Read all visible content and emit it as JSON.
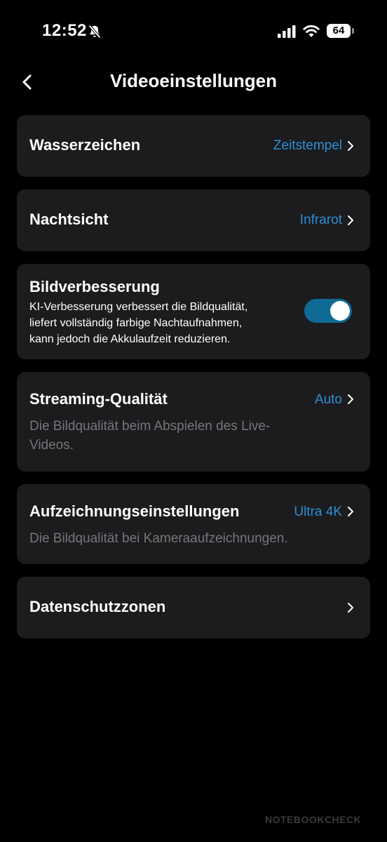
{
  "status": {
    "time": "12:52",
    "battery": "64",
    "icons": [
      "bell-slash-icon",
      "cellular-signal-icon",
      "wifi-icon",
      "battery-icon"
    ]
  },
  "header": {
    "title": "Videoeinstellungen",
    "back_icon": "chevron-left-icon"
  },
  "settings": {
    "watermark": {
      "title": "Wasserzeichen",
      "value": "Zeitstempel"
    },
    "night_vision": {
      "title": "Nachtsicht",
      "value": "Infrarot"
    },
    "enhancement": {
      "title": "Bildverbesserung",
      "desc_line1": "KI-Verbesserung verbessert die Bildqualität,",
      "desc_line2": "liefert vollständig farbige Nachtaufnahmen,",
      "desc_line3": "kann jedoch die Akkulaufzeit reduzieren.",
      "enabled": true
    },
    "streaming": {
      "title": "Streaming-Qualität",
      "value": "Auto",
      "desc_line1": "Die Bildqualität beim Abspielen des Live-",
      "desc_line2": "Videos."
    },
    "recording": {
      "title": "Aufzeichnungseinstellungen",
      "value": "Ultra 4K",
      "desc": "Die Bildqualität bei Kameraaufzeichnungen."
    },
    "privacy": {
      "title": "Datenschutzzonen"
    }
  },
  "colors": {
    "background": "#000000",
    "card": "#1c1c1e",
    "accent": "#2e8fd6",
    "toggle_on": "#0f6a96",
    "secondary_text": "#76767a"
  },
  "watermark_text": "NOTEBOOKCHECK"
}
